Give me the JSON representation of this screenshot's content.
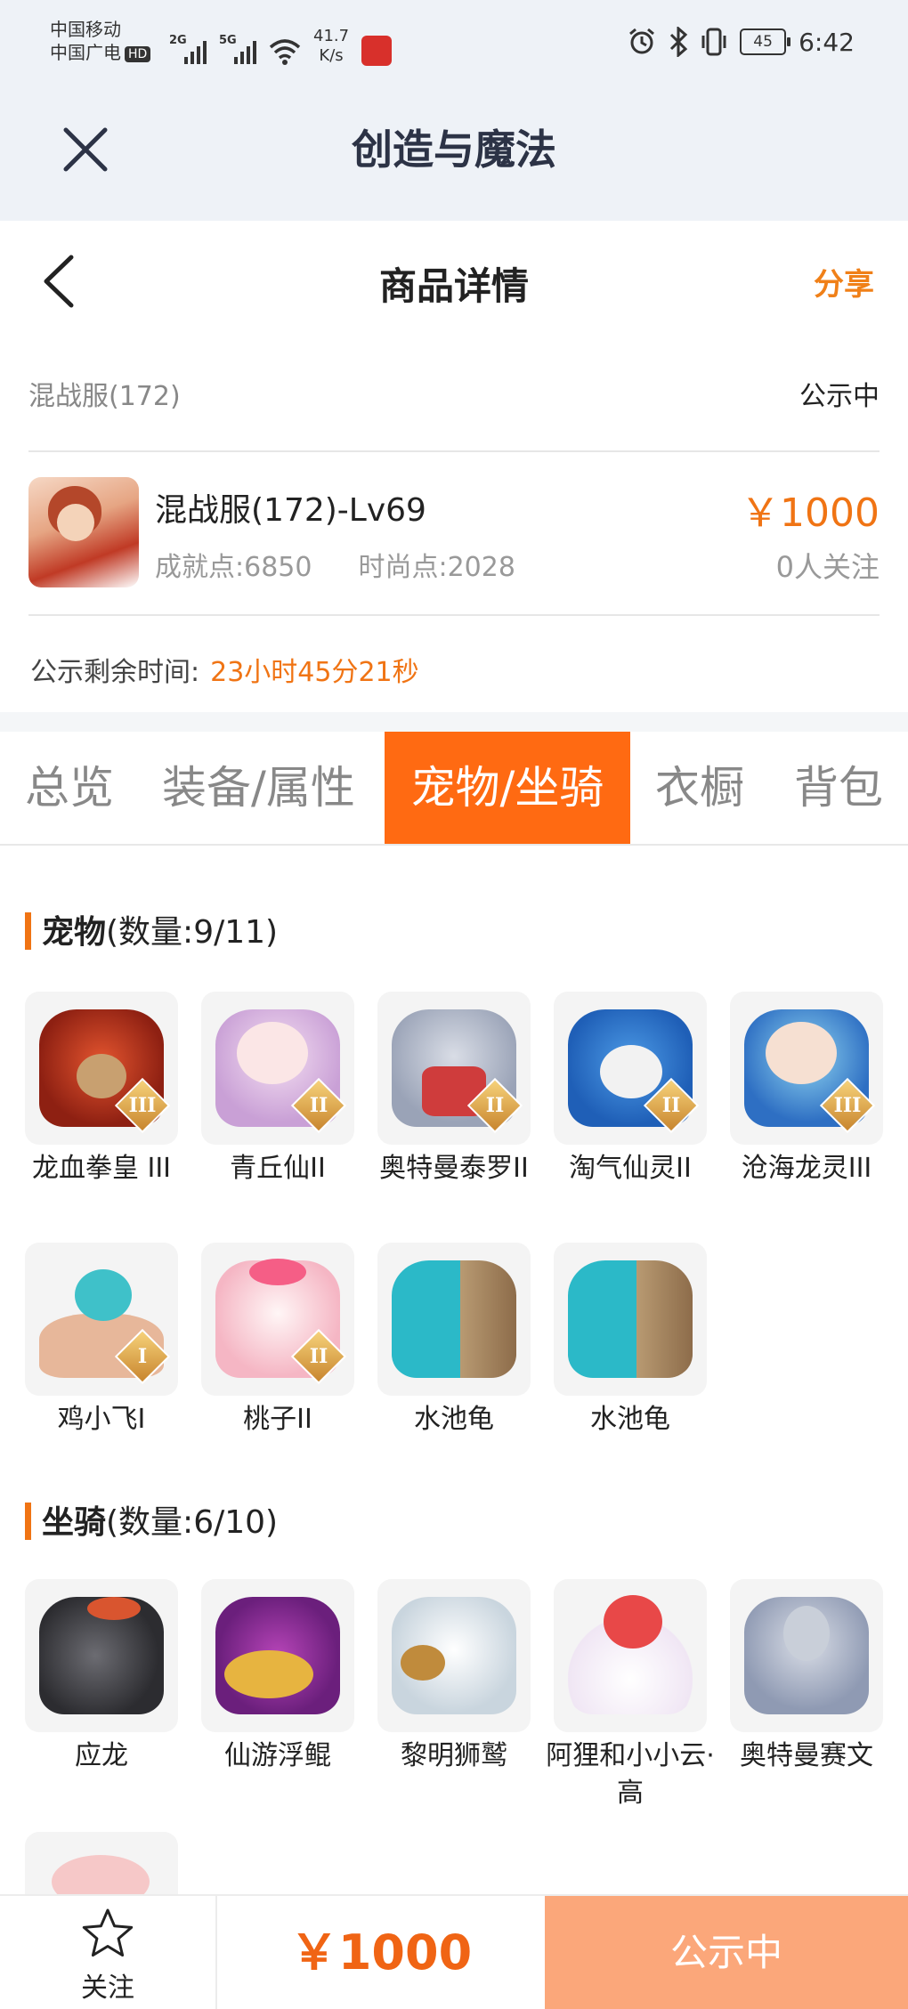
{
  "status_bar": {
    "carrier1": "中国移动",
    "carrier2": "中国广电",
    "hd": "HD",
    "net1": "2G",
    "net2": "5G",
    "speed_value": "41.7",
    "speed_unit": "K/s",
    "battery": "45",
    "time": "6:42"
  },
  "app": {
    "title": "创造与魔法"
  },
  "header": {
    "title": "商品详情",
    "share": "分享"
  },
  "server": {
    "name": "混战服(172)",
    "status": "公示中"
  },
  "product": {
    "name": "混战服(172)-Lv69",
    "achievement": "成就点:6850",
    "fashion": "时尚点:2028",
    "price": "￥1000",
    "followers": "0人关注"
  },
  "remaining": {
    "label": "公示剩余时间:",
    "value": "23小时45分21秒"
  },
  "tabs": [
    "总览",
    "装备/属性",
    "宠物/坐骑",
    "衣橱",
    "背包"
  ],
  "pets": {
    "title": "宠物",
    "count": "(数量:9/11)",
    "items": [
      {
        "name": "龙血拳皇 III",
        "grade": "III"
      },
      {
        "name": "青丘仙II",
        "grade": "II"
      },
      {
        "name": "奥特曼泰罗II",
        "grade": "II"
      },
      {
        "name": "淘气仙灵II",
        "grade": "II"
      },
      {
        "name": "沧海龙灵III",
        "grade": "III"
      },
      {
        "name": "鸡小飞I",
        "grade": "I"
      },
      {
        "name": "桃子II",
        "grade": "II"
      },
      {
        "name": "水池龟",
        "grade": ""
      },
      {
        "name": "水池龟",
        "grade": ""
      }
    ]
  },
  "mounts": {
    "title": "坐骑",
    "count": "(数量:6/10)",
    "items": [
      {
        "name": "应龙"
      },
      {
        "name": "仙游浮鲲"
      },
      {
        "name": "黎明狮鹫"
      },
      {
        "name": "阿狸和小小云·高"
      },
      {
        "name": "奥特曼赛文"
      }
    ]
  },
  "bottom": {
    "follow": "关注",
    "price": "￥1000",
    "status": "公示中"
  },
  "colors": {
    "accent": "#f07414",
    "tab_active": "#ff6a12",
    "status_btn": "#fba77a"
  }
}
